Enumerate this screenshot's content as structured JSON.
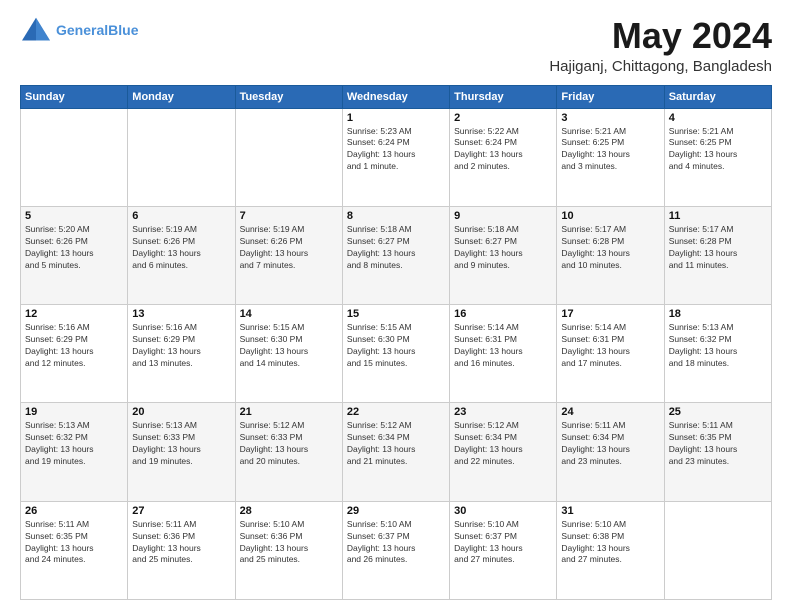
{
  "header": {
    "logo_line1": "General",
    "logo_line2": "Blue",
    "month_year": "May 2024",
    "location": "Hajiganj, Chittagong, Bangladesh"
  },
  "weekdays": [
    "Sunday",
    "Monday",
    "Tuesday",
    "Wednesday",
    "Thursday",
    "Friday",
    "Saturday"
  ],
  "weeks": [
    [
      {
        "day": "",
        "info": ""
      },
      {
        "day": "",
        "info": ""
      },
      {
        "day": "",
        "info": ""
      },
      {
        "day": "1",
        "info": "Sunrise: 5:23 AM\nSunset: 6:24 PM\nDaylight: 13 hours\nand 1 minute."
      },
      {
        "day": "2",
        "info": "Sunrise: 5:22 AM\nSunset: 6:24 PM\nDaylight: 13 hours\nand 2 minutes."
      },
      {
        "day": "3",
        "info": "Sunrise: 5:21 AM\nSunset: 6:25 PM\nDaylight: 13 hours\nand 3 minutes."
      },
      {
        "day": "4",
        "info": "Sunrise: 5:21 AM\nSunset: 6:25 PM\nDaylight: 13 hours\nand 4 minutes."
      }
    ],
    [
      {
        "day": "5",
        "info": "Sunrise: 5:20 AM\nSunset: 6:26 PM\nDaylight: 13 hours\nand 5 minutes."
      },
      {
        "day": "6",
        "info": "Sunrise: 5:19 AM\nSunset: 6:26 PM\nDaylight: 13 hours\nand 6 minutes."
      },
      {
        "day": "7",
        "info": "Sunrise: 5:19 AM\nSunset: 6:26 PM\nDaylight: 13 hours\nand 7 minutes."
      },
      {
        "day": "8",
        "info": "Sunrise: 5:18 AM\nSunset: 6:27 PM\nDaylight: 13 hours\nand 8 minutes."
      },
      {
        "day": "9",
        "info": "Sunrise: 5:18 AM\nSunset: 6:27 PM\nDaylight: 13 hours\nand 9 minutes."
      },
      {
        "day": "10",
        "info": "Sunrise: 5:17 AM\nSunset: 6:28 PM\nDaylight: 13 hours\nand 10 minutes."
      },
      {
        "day": "11",
        "info": "Sunrise: 5:17 AM\nSunset: 6:28 PM\nDaylight: 13 hours\nand 11 minutes."
      }
    ],
    [
      {
        "day": "12",
        "info": "Sunrise: 5:16 AM\nSunset: 6:29 PM\nDaylight: 13 hours\nand 12 minutes."
      },
      {
        "day": "13",
        "info": "Sunrise: 5:16 AM\nSunset: 6:29 PM\nDaylight: 13 hours\nand 13 minutes."
      },
      {
        "day": "14",
        "info": "Sunrise: 5:15 AM\nSunset: 6:30 PM\nDaylight: 13 hours\nand 14 minutes."
      },
      {
        "day": "15",
        "info": "Sunrise: 5:15 AM\nSunset: 6:30 PM\nDaylight: 13 hours\nand 15 minutes."
      },
      {
        "day": "16",
        "info": "Sunrise: 5:14 AM\nSunset: 6:31 PM\nDaylight: 13 hours\nand 16 minutes."
      },
      {
        "day": "17",
        "info": "Sunrise: 5:14 AM\nSunset: 6:31 PM\nDaylight: 13 hours\nand 17 minutes."
      },
      {
        "day": "18",
        "info": "Sunrise: 5:13 AM\nSunset: 6:32 PM\nDaylight: 13 hours\nand 18 minutes."
      }
    ],
    [
      {
        "day": "19",
        "info": "Sunrise: 5:13 AM\nSunset: 6:32 PM\nDaylight: 13 hours\nand 19 minutes."
      },
      {
        "day": "20",
        "info": "Sunrise: 5:13 AM\nSunset: 6:33 PM\nDaylight: 13 hours\nand 19 minutes."
      },
      {
        "day": "21",
        "info": "Sunrise: 5:12 AM\nSunset: 6:33 PM\nDaylight: 13 hours\nand 20 minutes."
      },
      {
        "day": "22",
        "info": "Sunrise: 5:12 AM\nSunset: 6:34 PM\nDaylight: 13 hours\nand 21 minutes."
      },
      {
        "day": "23",
        "info": "Sunrise: 5:12 AM\nSunset: 6:34 PM\nDaylight: 13 hours\nand 22 minutes."
      },
      {
        "day": "24",
        "info": "Sunrise: 5:11 AM\nSunset: 6:34 PM\nDaylight: 13 hours\nand 23 minutes."
      },
      {
        "day": "25",
        "info": "Sunrise: 5:11 AM\nSunset: 6:35 PM\nDaylight: 13 hours\nand 23 minutes."
      }
    ],
    [
      {
        "day": "26",
        "info": "Sunrise: 5:11 AM\nSunset: 6:35 PM\nDaylight: 13 hours\nand 24 minutes."
      },
      {
        "day": "27",
        "info": "Sunrise: 5:11 AM\nSunset: 6:36 PM\nDaylight: 13 hours\nand 25 minutes."
      },
      {
        "day": "28",
        "info": "Sunrise: 5:10 AM\nSunset: 6:36 PM\nDaylight: 13 hours\nand 25 minutes."
      },
      {
        "day": "29",
        "info": "Sunrise: 5:10 AM\nSunset: 6:37 PM\nDaylight: 13 hours\nand 26 minutes."
      },
      {
        "day": "30",
        "info": "Sunrise: 5:10 AM\nSunset: 6:37 PM\nDaylight: 13 hours\nand 27 minutes."
      },
      {
        "day": "31",
        "info": "Sunrise: 5:10 AM\nSunset: 6:38 PM\nDaylight: 13 hours\nand 27 minutes."
      },
      {
        "day": "",
        "info": ""
      }
    ]
  ]
}
